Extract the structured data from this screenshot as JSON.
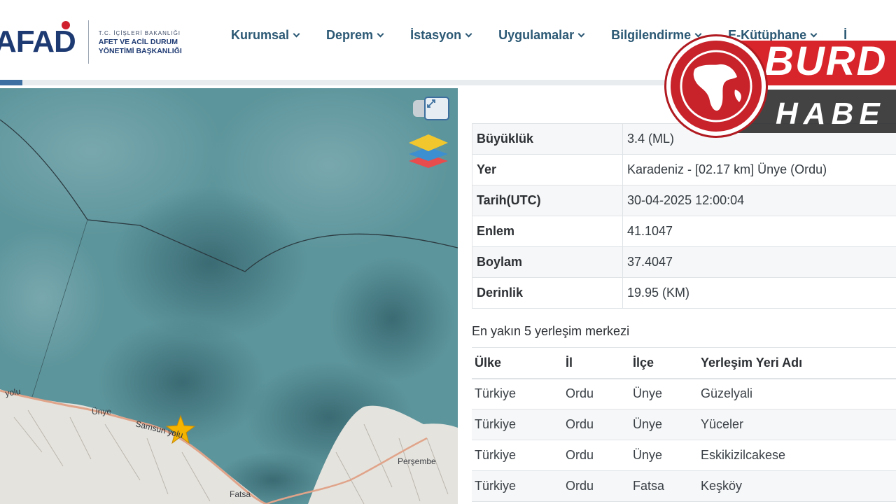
{
  "header": {
    "logo": "AFAD",
    "logo_lines": [
      "T.C. İÇİŞLERİ BAKANLIĞI",
      "AFET VE ACİL DURUM",
      "YÖNETİMİ BAŞKANLIĞI"
    ],
    "nav": [
      "Kurumsal",
      "Deprem",
      "İstasyon",
      "Uygulamalar",
      "Bilgilendirme",
      "E-Kütüphane",
      "İ"
    ]
  },
  "map": {
    "labels": {
      "unye": "Ünye",
      "samsun_yolu": "Samsun yolu",
      "yolu_left": "yolu",
      "fatsa": "Fatsa",
      "persembe": "Perşembe"
    },
    "icons": {
      "fullscreen": "expand-arrows-icon",
      "layers": "layers-icon",
      "epicenter": "star-icon"
    },
    "colors": {
      "sea": "#4f8a92",
      "land": "#e7e5df",
      "epicenter": "#f4b400"
    }
  },
  "watermark": {
    "line1": "BURD",
    "line2": "HABE"
  },
  "details": [
    {
      "key": "Büyüklük",
      "value": "3.4 (ML)"
    },
    {
      "key": "Yer",
      "value": "Karadeniz - [02.17 km] Ünye (Ordu)"
    },
    {
      "key": "Tarih(UTC)",
      "value": "30-04-2025 12:00:04"
    },
    {
      "key": "Enlem",
      "value": "41.1047"
    },
    {
      "key": "Boylam",
      "value": "37.4047"
    },
    {
      "key": "Derinlik",
      "value": "19.95 (KM)"
    }
  ],
  "nearest": {
    "title": "En yakın 5 yerleşim merkezi",
    "columns": [
      "Ülke",
      "İl",
      "İlçe",
      "Yerleşim Yeri Adı"
    ],
    "rows": [
      [
        "Türkiye",
        "Ordu",
        "Ünye",
        "Güzelyali"
      ],
      [
        "Türkiye",
        "Ordu",
        "Ünye",
        "Yüceler"
      ],
      [
        "Türkiye",
        "Ordu",
        "Ünye",
        "Eskikizilcakese"
      ],
      [
        "Türkiye",
        "Ordu",
        "Fatsa",
        "Keşköy"
      ]
    ]
  }
}
